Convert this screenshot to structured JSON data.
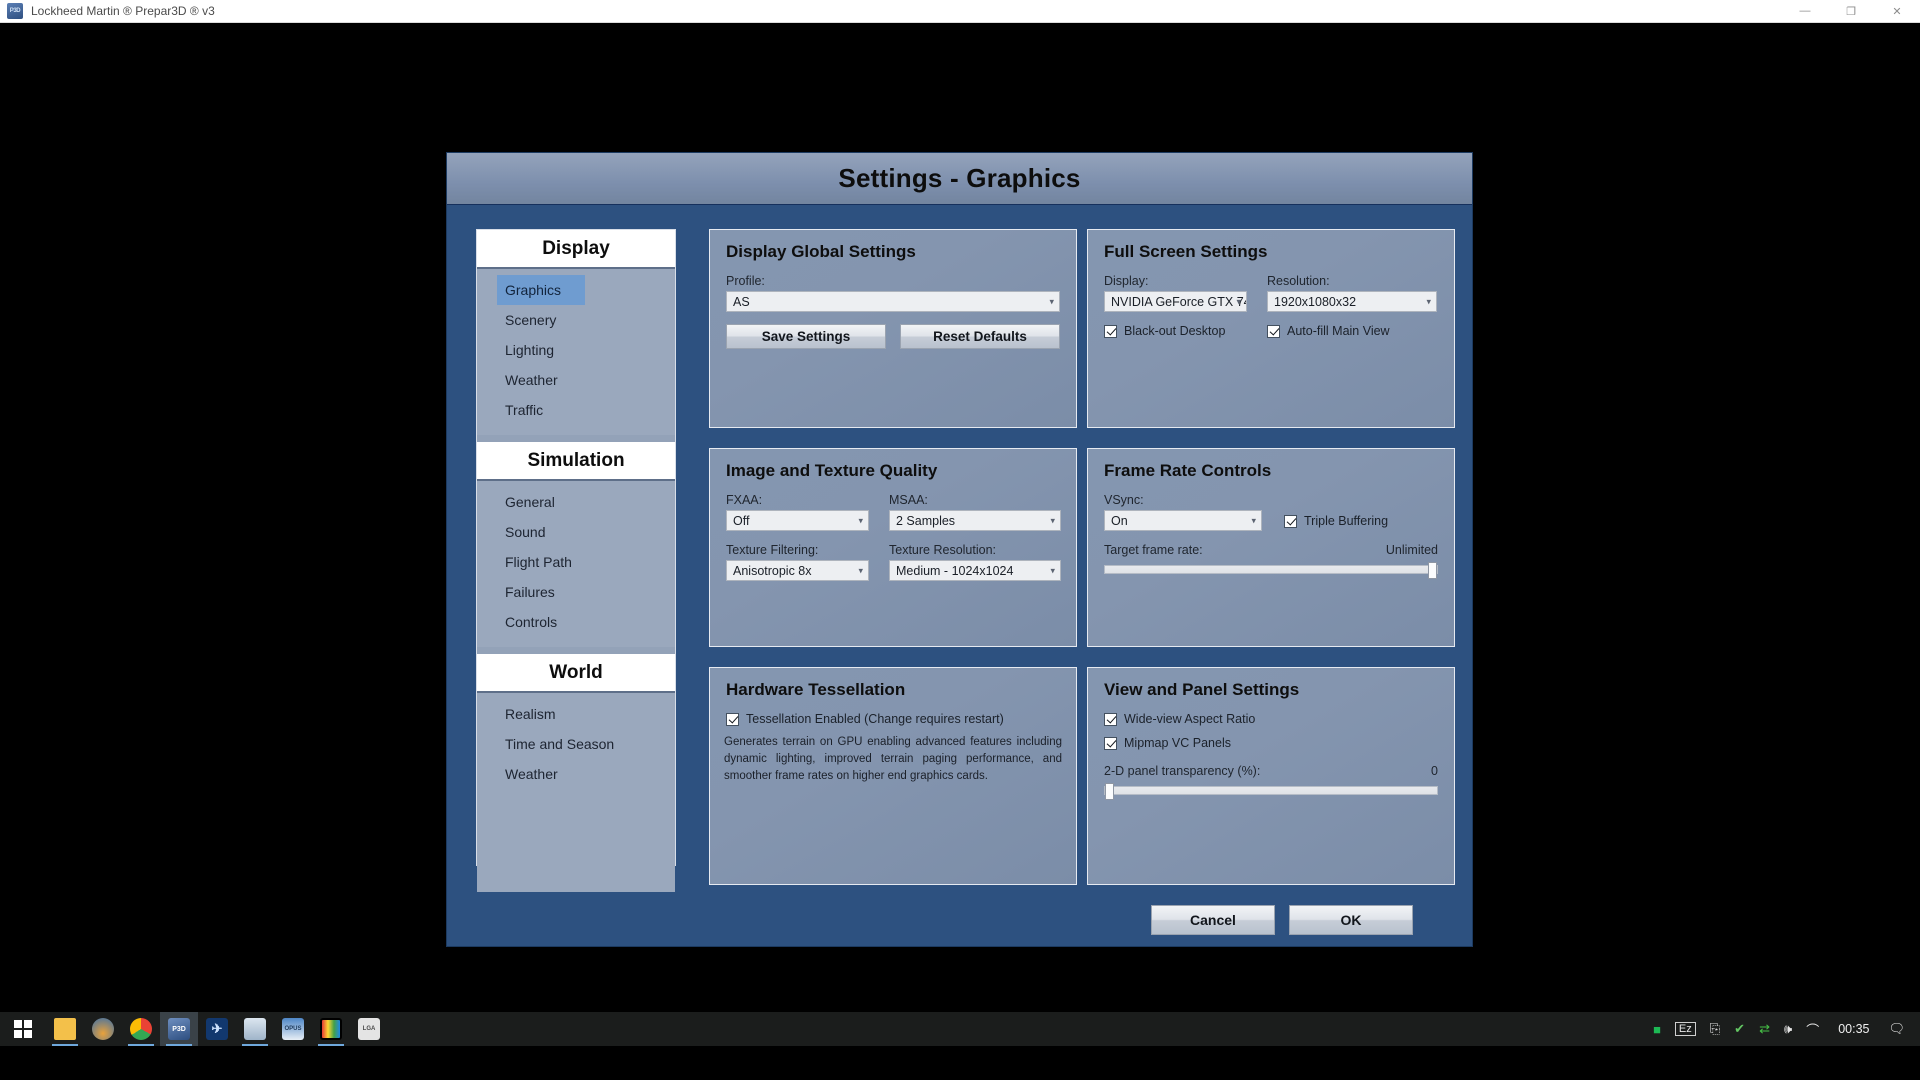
{
  "window": {
    "title": "Lockheed Martin ® Prepar3D ® v3",
    "icon": "p3d-app-icon",
    "minimize": "—",
    "maximize": "❐",
    "close": "✕"
  },
  "dialog": {
    "title": "Settings - Graphics"
  },
  "sidebar": {
    "groups": [
      {
        "header": "Display",
        "items": [
          {
            "label": "Graphics",
            "selected": true
          },
          {
            "label": "Scenery",
            "selected": false
          },
          {
            "label": "Lighting",
            "selected": false
          },
          {
            "label": "Weather",
            "selected": false
          },
          {
            "label": "Traffic",
            "selected": false
          }
        ]
      },
      {
        "header": "Simulation",
        "items": [
          {
            "label": "General",
            "selected": false
          },
          {
            "label": "Sound",
            "selected": false
          },
          {
            "label": "Flight Path",
            "selected": false
          },
          {
            "label": "Failures",
            "selected": false
          },
          {
            "label": "Controls",
            "selected": false
          }
        ]
      },
      {
        "header": "World",
        "items": [
          {
            "label": "Realism",
            "selected": false
          },
          {
            "label": "Time and Season",
            "selected": false
          },
          {
            "label": "Weather",
            "selected": false
          }
        ]
      }
    ]
  },
  "panels": {
    "display_global": {
      "title": "Display Global Settings",
      "profile_label": "Profile:",
      "profile_value": "AS",
      "save_button": "Save Settings",
      "reset_button": "Reset Defaults"
    },
    "full_screen": {
      "title": "Full Screen Settings",
      "display_label": "Display:",
      "display_value": "NVIDIA GeForce GTX 74",
      "resolution_label": "Resolution:",
      "resolution_value": "1920x1080x32",
      "blackout_label": "Black-out Desktop",
      "blackout_checked": true,
      "autofill_label": "Auto-fill Main View",
      "autofill_checked": true
    },
    "image_texture": {
      "title": "Image and Texture Quality",
      "fxaa_label": "FXAA:",
      "fxaa_value": "Off",
      "msaa_label": "MSAA:",
      "msaa_value": "2 Samples",
      "texture_filtering_label": "Texture Filtering:",
      "texture_filtering_value": "Anisotropic 8x",
      "texture_resolution_label": "Texture Resolution:",
      "texture_resolution_value": "Medium - 1024x1024"
    },
    "frame_rate": {
      "title": "Frame Rate Controls",
      "vsync_label": "VSync:",
      "vsync_value": "On",
      "triple_buffering_label": "Triple Buffering",
      "triple_buffering_checked": true,
      "target_frame_rate_label": "Target frame rate:",
      "target_frame_rate_value": "Unlimited",
      "target_frame_rate_percent": 100
    },
    "tessellation": {
      "title": "Hardware Tessellation",
      "enabled_label": "Tessellation Enabled (Change requires restart)",
      "enabled_checked": true,
      "description": "Generates terrain on GPU enabling advanced features including dynamic lighting, improved terrain paging performance, and smoother frame rates on higher end graphics cards."
    },
    "view_panel": {
      "title": "View and Panel Settings",
      "wideview_label": "Wide-view Aspect Ratio",
      "wideview_checked": true,
      "mipmap_label": "Mipmap VC Panels",
      "mipmap_checked": true,
      "transparency_label": "2-D panel transparency (%):",
      "transparency_value": "0",
      "transparency_percent": 0
    }
  },
  "footer": {
    "cancel": "Cancel",
    "ok": "OK"
  },
  "taskbar": {
    "start_icon": "windows-start-icon",
    "apps": [
      {
        "name": "file-explorer-icon",
        "glyph": "",
        "color": "#f0b849",
        "active": false
      },
      {
        "name": "photos-icon",
        "glyph": "",
        "color": "#e08a3c",
        "active": false
      },
      {
        "name": "chrome-icon",
        "glyph": "",
        "color": "#4285f4",
        "active": false
      },
      {
        "name": "prepar3d-icon",
        "glyph": "P3D",
        "color": "#4a6fa5",
        "active": true
      },
      {
        "name": "plane-tool-icon",
        "glyph": "✈",
        "color": "#1c4e8a",
        "active": false
      },
      {
        "name": "fsuipc-icon",
        "glyph": "",
        "color": "#c8d4e0",
        "active": false
      },
      {
        "name": "opus-icon",
        "glyph": "OPUS",
        "color": "#3a6fa8",
        "active": false
      },
      {
        "name": "color-tool-icon",
        "glyph": "",
        "color": "#2fa84f",
        "active": false
      },
      {
        "name": "legacy-app-icon",
        "glyph": "LGA",
        "color": "#d8d8d8",
        "active": false
      }
    ],
    "tray": [
      {
        "name": "green-status-icon",
        "glyph": "■",
        "color": "#1db954"
      },
      {
        "name": "ez-icon",
        "glyph": "Ez",
        "color": "#e6e6e6"
      },
      {
        "name": "usb-eject-icon",
        "glyph": "⎙",
        "color": "#e6e6e6"
      },
      {
        "name": "security-shield-icon",
        "glyph": "✔",
        "color": "#63c663"
      },
      {
        "name": "network-sync-icon",
        "glyph": "⇄",
        "color": "#46c246"
      },
      {
        "name": "volume-icon",
        "glyph": "🔊",
        "color": "#e6e6e6"
      },
      {
        "name": "wifi-icon",
        "glyph": "📶",
        "color": "#e6e6e6"
      }
    ],
    "clock": "00:35",
    "action_center_icon": "action-center-icon"
  }
}
